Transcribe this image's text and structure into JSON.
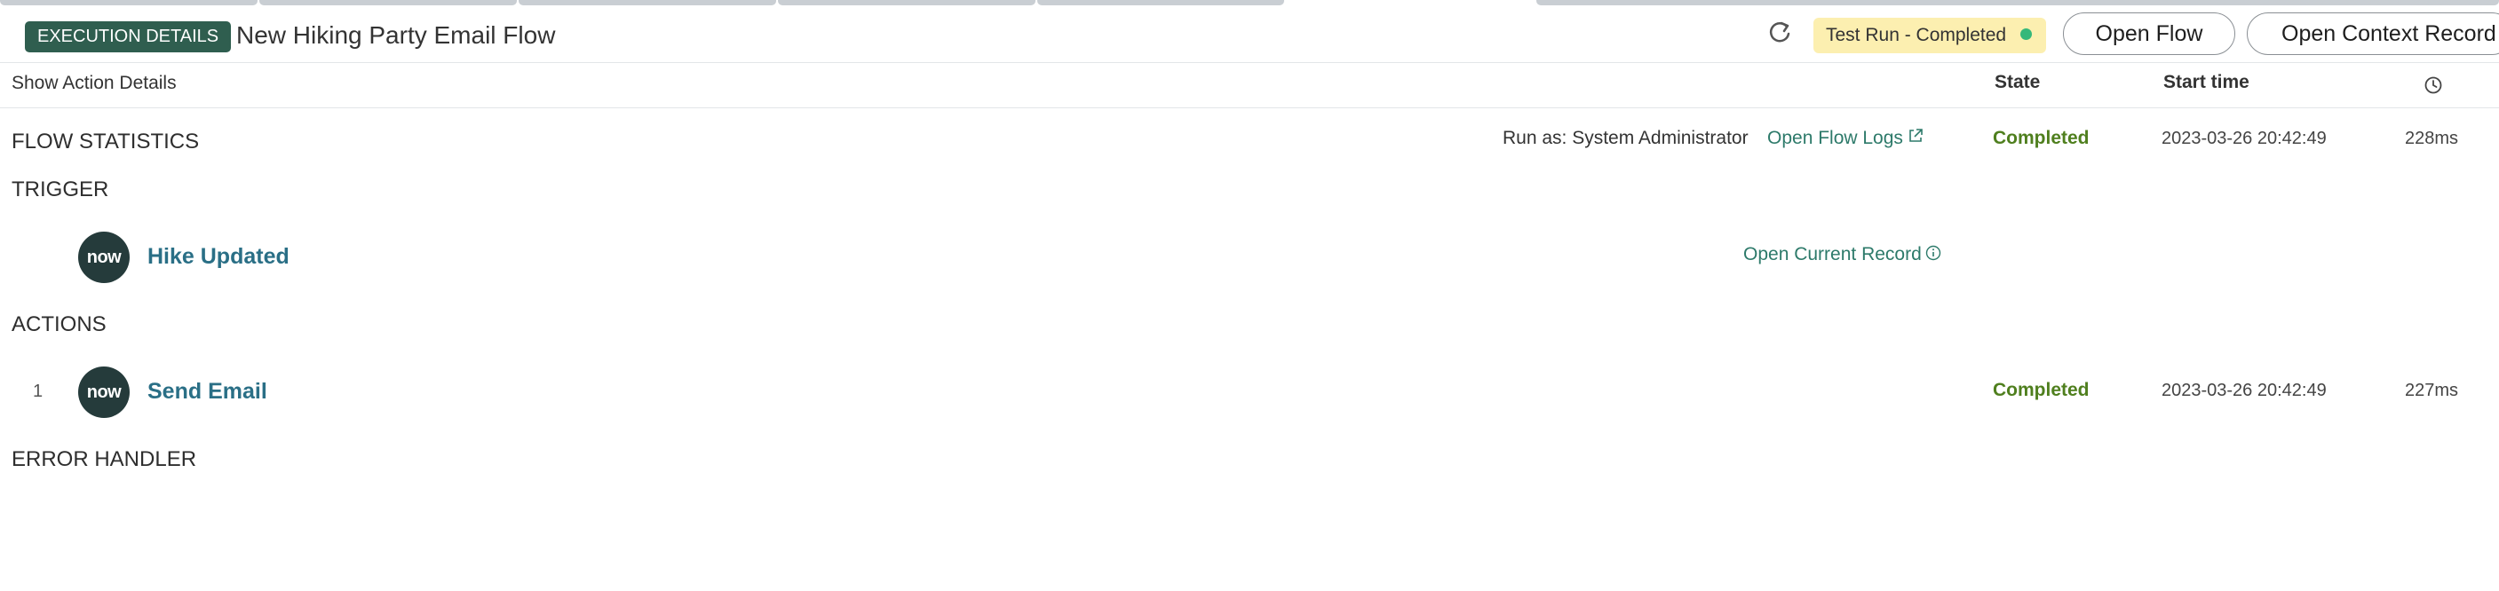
{
  "header": {
    "badge_label": "EXECUTION DETAILS",
    "flow_title": "New Hiking Party Email Flow",
    "refresh_icon": "refresh-icon",
    "status_label": "Test Run - Completed",
    "status_dot_color": "#35b87a",
    "open_flow_label": "Open Flow",
    "open_context_label": "Open Context Record"
  },
  "columns": {
    "show_action_details": "Show Action Details",
    "state": "State",
    "start_time": "Start time",
    "duration_icon": "clock-icon"
  },
  "flow_statistics": {
    "heading": "FLOW STATISTICS",
    "run_as": "Run as: System Administrator",
    "open_flow_logs": "Open Flow Logs",
    "state": "Completed",
    "start_time": "2023-03-26 20:42:49",
    "duration": "228ms"
  },
  "trigger": {
    "heading": "TRIGGER",
    "logo_text": "now",
    "name": "Hike Updated",
    "open_current_record": "Open Current Record"
  },
  "actions": {
    "heading": "ACTIONS",
    "items": [
      {
        "number": "1",
        "logo_text": "now",
        "name": "Send Email",
        "state": "Completed",
        "start_time": "2023-03-26 20:42:49",
        "duration": "227ms"
      }
    ]
  },
  "error_handler": {
    "heading": "ERROR HANDLER"
  },
  "colors": {
    "badge_bg": "#2f5e4f",
    "status_bg": "#fcefb0",
    "completed": "#4f7f1e",
    "link": "#2d7a6a",
    "item_name": "#2a6f86"
  }
}
